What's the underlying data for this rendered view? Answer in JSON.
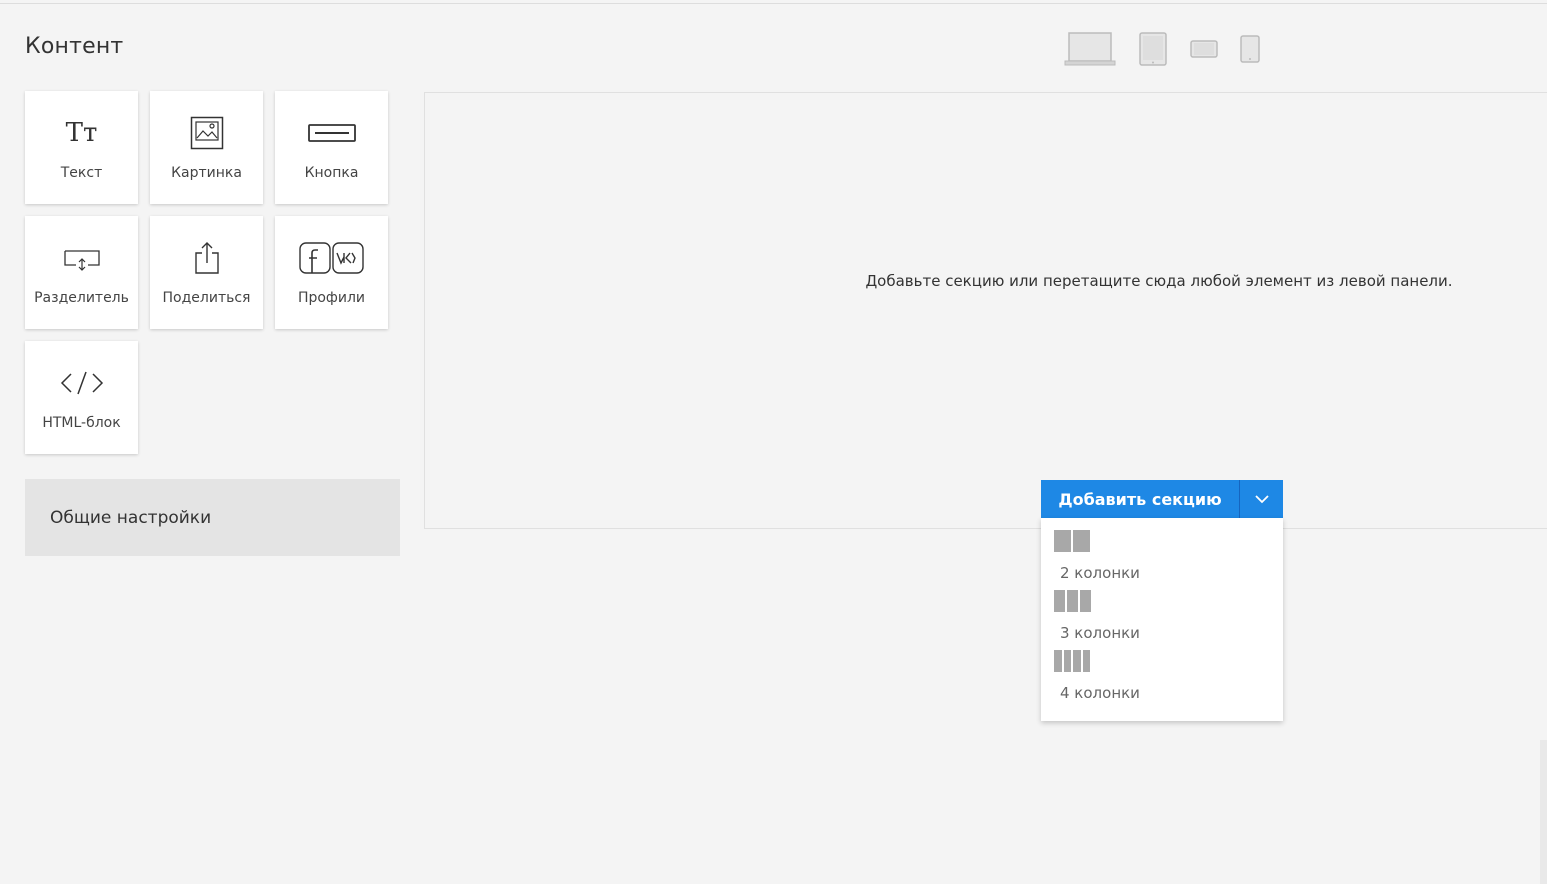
{
  "panel": {
    "title": "Контент"
  },
  "tiles": [
    {
      "label": "Текст",
      "icon": "text-icon"
    },
    {
      "label": "Картинка",
      "icon": "image-icon"
    },
    {
      "label": "Кнопка",
      "icon": "button-icon"
    },
    {
      "label": "Разделитель",
      "icon": "divider-icon"
    },
    {
      "label": "Поделиться",
      "icon": "share-icon"
    },
    {
      "label": "Профили",
      "icon": "social-profiles-icon"
    },
    {
      "label": "HTML-блок",
      "icon": "code-icon"
    }
  ],
  "text_icon_glyph": "Tт",
  "general_settings": "Общие настройки",
  "devices": [
    "desktop-icon",
    "tablet-portrait-icon",
    "tablet-landscape-icon",
    "mobile-icon"
  ],
  "canvas": {
    "message": "Добавьте секцию или перетащите сюда любой элемент из левой панели."
  },
  "add_section": {
    "label": "Добавить секцию",
    "options": [
      {
        "label": "2 колонки",
        "columns": 2
      },
      {
        "label": "3 колонки",
        "columns": 3
      },
      {
        "label": "4 колонки",
        "columns": 4
      }
    ]
  },
  "colors": {
    "accent": "#1e88e5",
    "background": "#f4f4f4",
    "tile": "#ffffff"
  }
}
